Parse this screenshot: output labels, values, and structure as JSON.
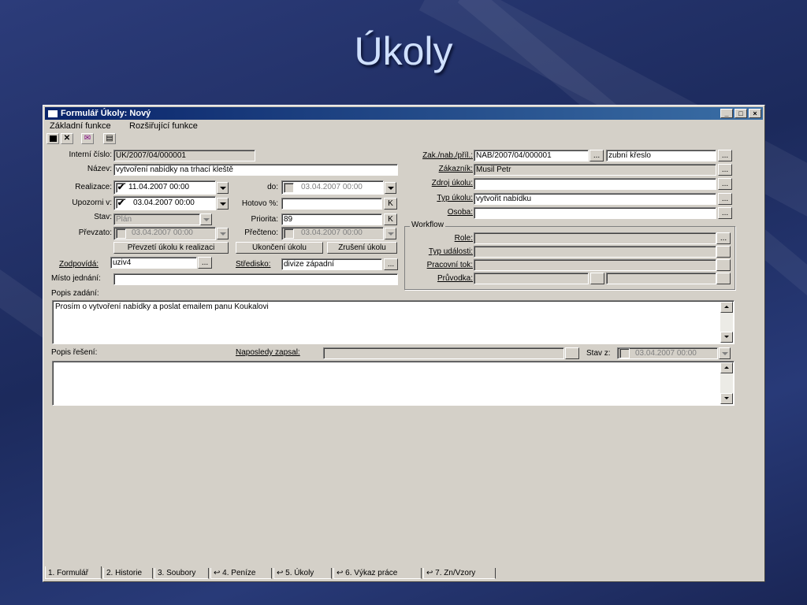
{
  "slide": {
    "title": "Úkoly"
  },
  "window": {
    "title": "Formulář Úkoly: Nový",
    "minimize": "_",
    "maximize": "□",
    "close": "×"
  },
  "menu": {
    "items": [
      "Základní funkce",
      "Rozšiřující funkce"
    ]
  },
  "form": {
    "interni_cislo": {
      "label": "Interní číslo:",
      "value": "UK/2007/04/000001"
    },
    "nazev": {
      "label": "Název:",
      "value": "vytvoření nabídky na trhací kleště"
    },
    "realizace": {
      "label": "Realizace:",
      "value": "11.04.2007 00:00",
      "checked": true
    },
    "do": {
      "label": "do:",
      "value": "03.04.2007 00:00"
    },
    "upozorni": {
      "label": "Upozorni v:",
      "value": "03.04.2007 00:00",
      "checked": true
    },
    "hotovo": {
      "label": "Hotovo %:",
      "value": "",
      "k": "K"
    },
    "stav": {
      "label": "Stav:",
      "value": "Plán"
    },
    "priorita": {
      "label": "Priorita:",
      "value": "89",
      "k": "K"
    },
    "prevzato": {
      "label": "Převzato:",
      "value": "03.04.2007 00:00"
    },
    "precteno": {
      "label": "Přečteno:",
      "value": "03.04.2007 00:00"
    },
    "buttons": {
      "prevzeti": "Převzetí úkolu k realizaci",
      "ukonceni": "Ukončení úkolu",
      "zruseni": "Zrušení úkolu"
    },
    "zodpovida": {
      "label": "Zodpovídá:",
      "value": "uziv4"
    },
    "stredisko": {
      "label": "Středisko:",
      "value": "divize západní"
    },
    "misto": {
      "label": "Místo jednání:",
      "value": ""
    },
    "zak": {
      "label": "Zak./nab./příl.:",
      "value": "NAB/2007/04/000001",
      "extra": "zubní křeslo"
    },
    "zakaznik": {
      "label": "Zákazník:",
      "value": "Musil Petr"
    },
    "zdroj": {
      "label": "Zdroj úkolu:",
      "value": ""
    },
    "typ": {
      "label": "Typ úkolu:",
      "value": "vytvořit nabídku"
    },
    "osoba": {
      "label": "Osoba:",
      "value": ""
    },
    "workflow": {
      "title": "Workflow",
      "role": "Role:",
      "typ_udalosti": "Typ události:",
      "pracovni_tok": "Pracovní tok:",
      "pruvodka": "Průvodka:"
    },
    "popis_zadani": {
      "label": "Popis zadání:",
      "value": "Prosím o vytvoření nabídky a poslat emailem panu Koukalovi"
    },
    "popis_reseni": {
      "label": "Popis řešení:",
      "naposledy": "Naposledy zapsal:",
      "stav_z": "Stav z:",
      "stav_z_value": "03.04.2007 00:00"
    },
    "ellipsis": "..."
  },
  "tabs": [
    "1. Formulář",
    "2. Historie",
    "3. Soubory",
    "4. Peníze",
    "5. Úkoly",
    "6. Výkaz práce",
    "7. Zn/Vzory"
  ]
}
